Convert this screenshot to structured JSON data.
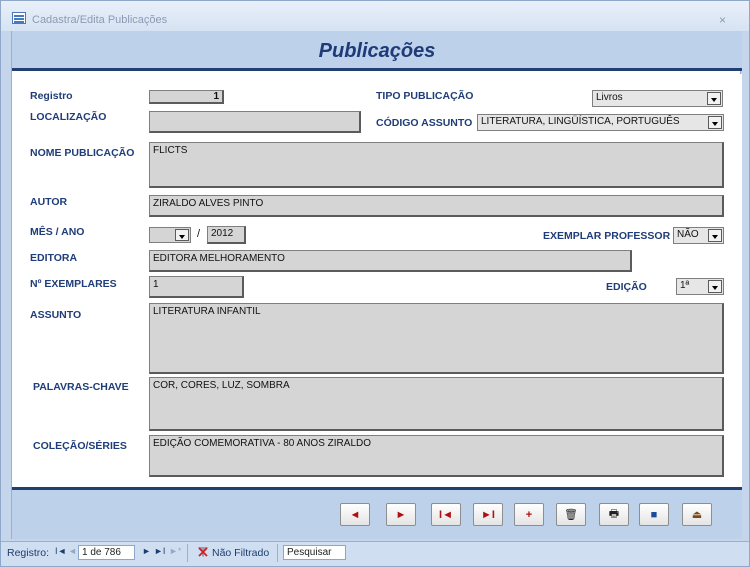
{
  "window": {
    "title": "Cadastra/Edita Publicações",
    "close_glyph": "×"
  },
  "form": {
    "heading": "Publicações"
  },
  "fields": {
    "registro": {
      "label": "Registro",
      "value": "1"
    },
    "localizacao": {
      "label": "LOCALIZAÇÃO",
      "value": ""
    },
    "tipo_publicacao": {
      "label": "TIPO PUBLICAÇÃO",
      "value": "Livros"
    },
    "codigo_assunto": {
      "label": "CÓDIGO ASSUNTO",
      "value": "LITERATURA, LINGÜÍSTICA, PORTUGUÊS"
    },
    "nome_publicacao": {
      "label": "NOME PUBLICAÇÃO",
      "value": "FLICTS"
    },
    "autor": {
      "label": "AUTOR",
      "value": "ZIRALDO ALVES PINTO"
    },
    "mes_ano": {
      "label": "MÊS / ANO",
      "month": "",
      "separator": "/",
      "year": "2012"
    },
    "exemplar_professor": {
      "label": "EXEMPLAR PROFESSOR",
      "value": "NÃO"
    },
    "editora": {
      "label": "EDITORA",
      "value": "EDITORA MELHORAMENTO"
    },
    "n_exemplares": {
      "label": "Nº EXEMPLARES",
      "value": "1"
    },
    "edicao": {
      "label": "EDIÇÃO",
      "value": "1ª"
    },
    "assunto": {
      "label": "ASSUNTO",
      "value": "LITERATURA INFANTIL"
    },
    "palavras_chave": {
      "label": "PALAVRAS-CHAVE",
      "value": "COR, CORES, LUZ, SOMBRA"
    },
    "colecao_series": {
      "label": "COLEÇÃO/SÉRIES",
      "value": "EDIÇÃO COMEMORATIVA - 80 ANOS ZIRALDO"
    }
  },
  "toolbar": {
    "buttons": [
      {
        "name": "previous-record-button",
        "icon": "triangle-left-icon",
        "glyph": "◄"
      },
      {
        "name": "next-record-button",
        "icon": "triangle-right-icon",
        "glyph": "►"
      },
      {
        "name": "first-record-button",
        "icon": "first-icon",
        "glyph": "I◄"
      },
      {
        "name": "last-record-button",
        "icon": "last-icon",
        "glyph": "►I"
      },
      {
        "name": "new-record-button",
        "icon": "plus-icon",
        "glyph": "+"
      },
      {
        "name": "delete-record-button",
        "icon": "trash-icon",
        "glyph": "🗑"
      },
      {
        "name": "print-button",
        "icon": "printer-icon",
        "glyph": "🖶"
      },
      {
        "name": "save-button",
        "icon": "disk-icon",
        "glyph": "■"
      },
      {
        "name": "exit-button",
        "icon": "exit-door-icon",
        "glyph": "⏏"
      }
    ]
  },
  "statusbar": {
    "record_label": "Registro:",
    "record_position": "1 de 786",
    "filter_text": "Não Filtrado",
    "search_placeholder": "Pesquisar",
    "nav_first": "I◄",
    "nav_prev": "◄",
    "nav_next": "►",
    "nav_last": "►I",
    "nav_new": "►*"
  },
  "colors": {
    "label_text": "#1f3d78",
    "header_band": "#bdd1ea",
    "accent_line": "#223f73",
    "field_bg": "#d5d5d5"
  }
}
